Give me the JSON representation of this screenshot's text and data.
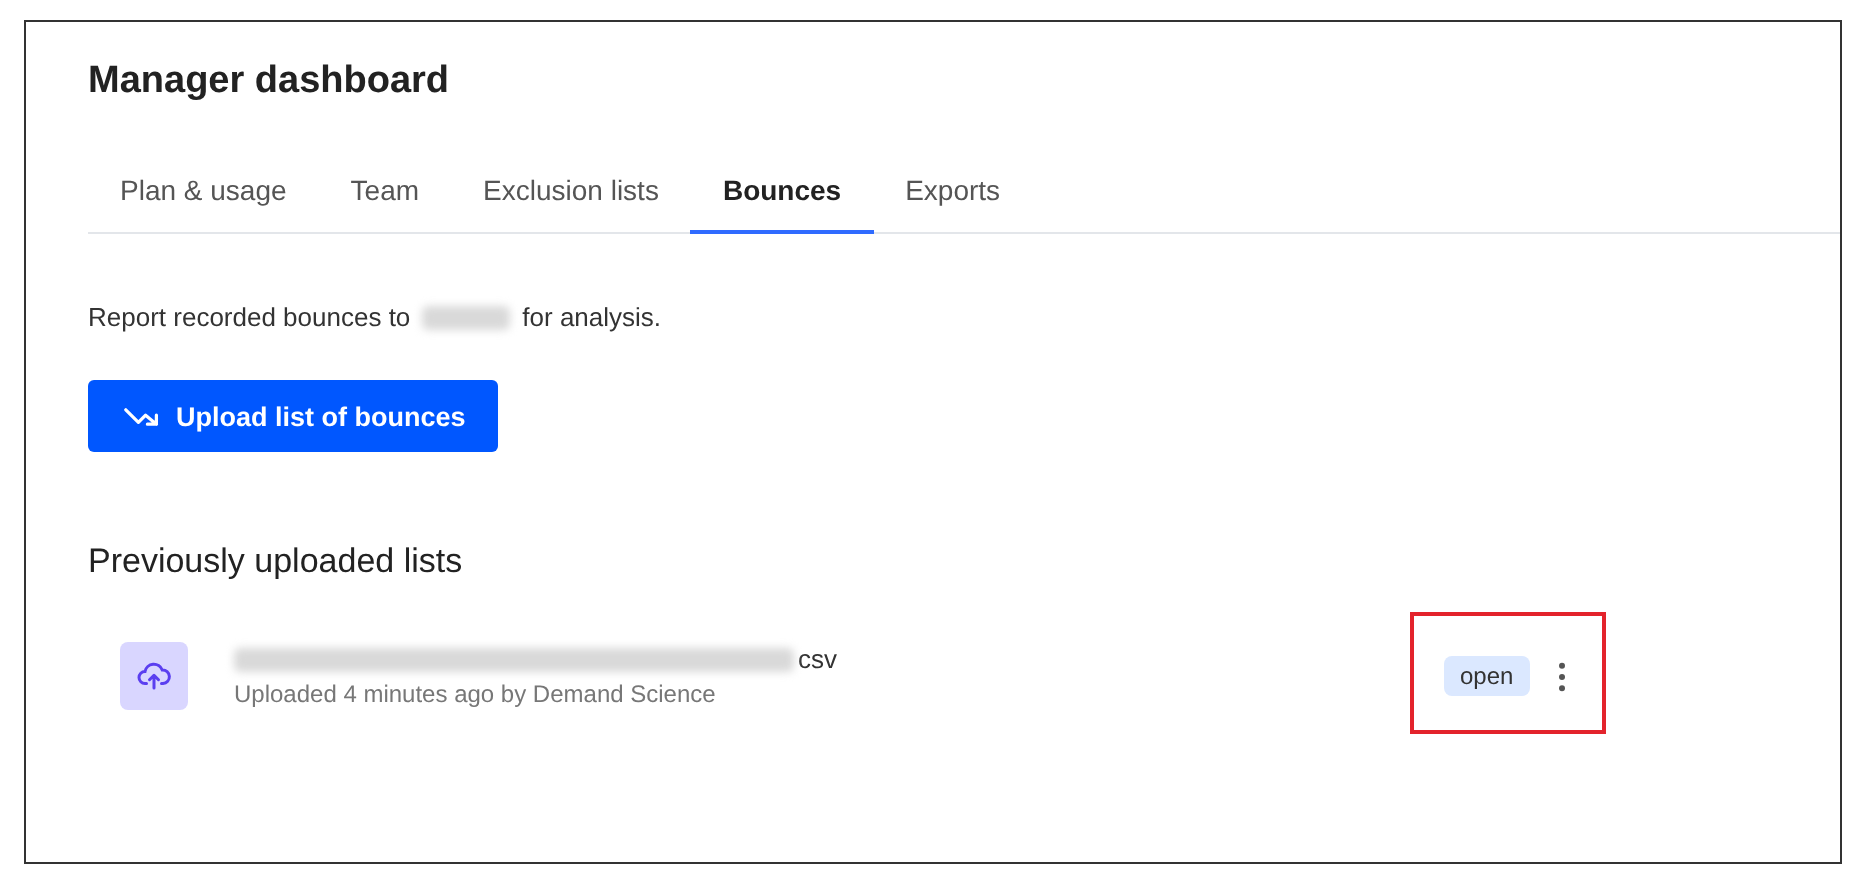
{
  "page": {
    "title": "Manager dashboard"
  },
  "tabs": [
    {
      "label": "Plan & usage",
      "selected": false
    },
    {
      "label": "Team",
      "selected": false
    },
    {
      "label": "Exclusion lists",
      "selected": false
    },
    {
      "label": "Bounces",
      "selected": true
    },
    {
      "label": "Exports",
      "selected": false
    }
  ],
  "description": {
    "before": "Report recorded bounces to",
    "after": "for analysis."
  },
  "upload_button": {
    "label": "Upload list of bounces"
  },
  "section_title": "Previously uploaded lists",
  "files": [
    {
      "name_suffix": "csv",
      "meta": "Uploaded 4 minutes ago by Demand Science",
      "status": "open",
      "highlighted": true
    }
  ]
}
